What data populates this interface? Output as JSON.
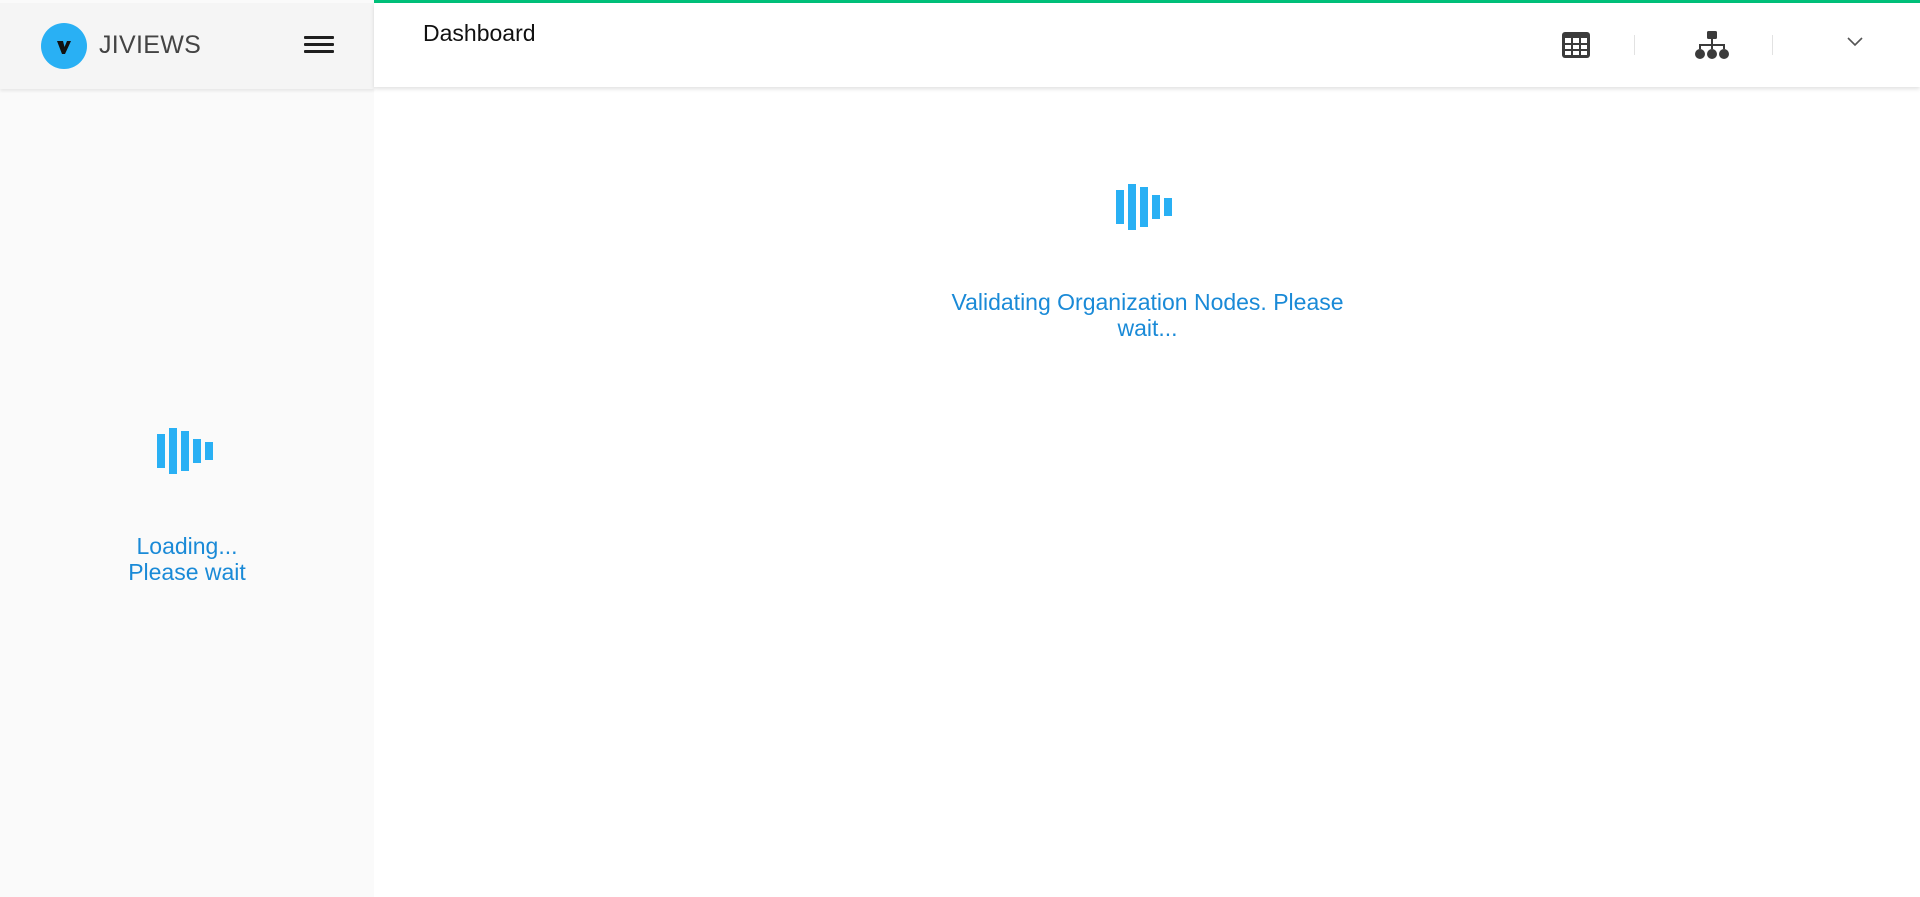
{
  "app": {
    "brand": "JIVIEWS",
    "logo_letter": "V"
  },
  "colors": {
    "accent_line": "#00c07a",
    "brand_blue": "#29b0f4",
    "loading_text": "#1a8ad7"
  },
  "header": {
    "title": "Dashboard",
    "icons": [
      "table-grid-icon",
      "org-chart-icon",
      "chevron-down-icon"
    ]
  },
  "main": {
    "status_message": "Validating Organization Nodes. Please wait..."
  },
  "sidebar": {
    "loading_message": "Loading... Please wait"
  }
}
